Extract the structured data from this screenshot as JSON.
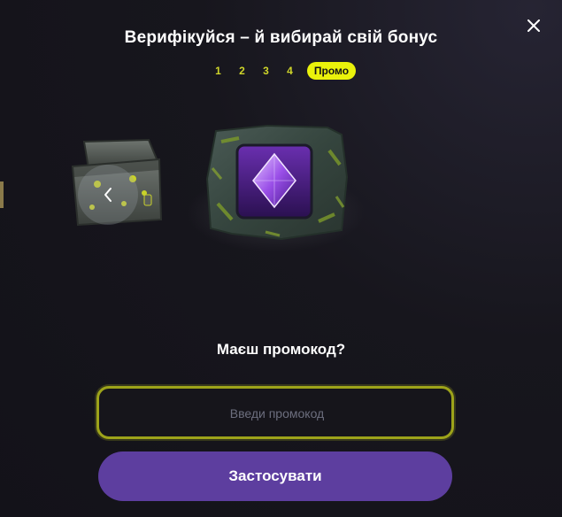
{
  "modal": {
    "title": "Верифікуйся – й вибирай свій бонус",
    "close_icon": "close-icon"
  },
  "steps": [
    {
      "label": "1",
      "active": false
    },
    {
      "label": "2",
      "active": false
    },
    {
      "label": "3",
      "active": false
    },
    {
      "label": "4",
      "active": false
    },
    {
      "label": "Промо",
      "active": true
    }
  ],
  "carousel": {
    "prev_icon": "chevron-left-icon",
    "items": [
      {
        "name": "treasure-chest-image"
      },
      {
        "name": "purple-gem-image"
      }
    ]
  },
  "promo": {
    "heading": "Маєш промокод?",
    "input_placeholder": "Введи промокод",
    "input_value": "",
    "apply_label": "Застосувати"
  },
  "colors": {
    "accent_yellow": "#eaf20b",
    "step_text": "#cfd52a",
    "input_border": "#9da31a",
    "button": "#5d3e9f",
    "background": "#15141b"
  }
}
